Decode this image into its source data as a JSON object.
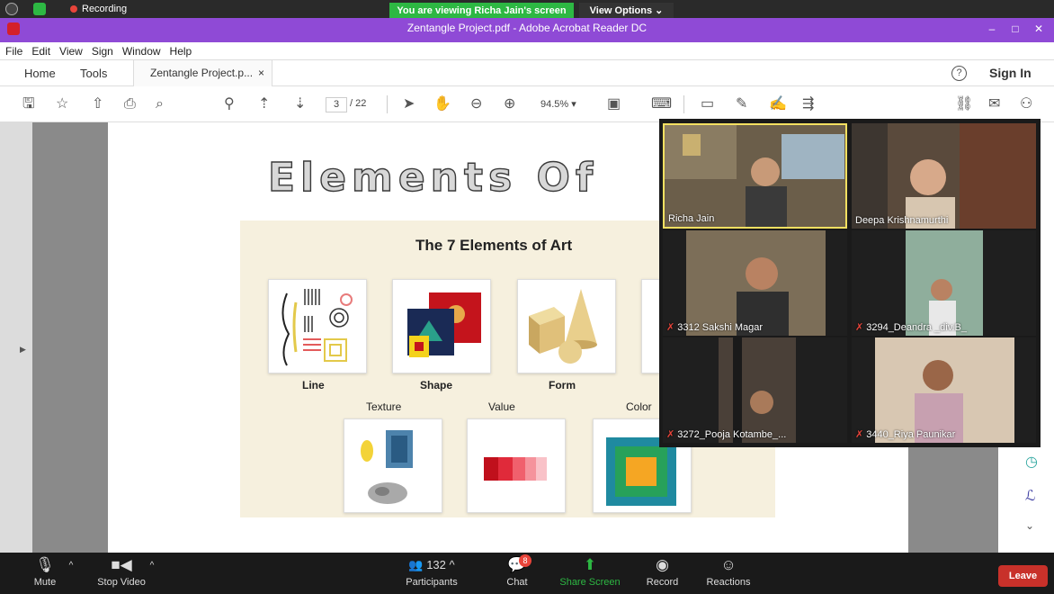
{
  "zoom_top": {
    "recording_label": "Recording",
    "viewing_banner": "You are viewing Richa Jain's screen",
    "view_options": "View Options ⌄"
  },
  "window": {
    "title": "Zentangle Project.pdf - Adobe Acrobat Reader DC",
    "minimize": "–",
    "maximize": "□",
    "close": "✕"
  },
  "menu": [
    "File",
    "Edit",
    "View",
    "Sign",
    "Window",
    "Help"
  ],
  "tabs": {
    "home": "Home",
    "tools": "Tools",
    "document": "Zentangle Project.p...",
    "close": "×",
    "sign_in": "Sign In",
    "help": "?"
  },
  "toolbar": {
    "page_current": "3",
    "page_total": "/ 22",
    "zoom": "94.5%  ▾"
  },
  "document": {
    "title": "Elements Of",
    "panel_title": "The 7 Elements of Art",
    "elements": {
      "line": "Line",
      "shape": "Shape",
      "form": "Form",
      "texture": "Texture",
      "value": "Value",
      "color": "Color"
    }
  },
  "participants_video": [
    {
      "name": "Richa Jain",
      "muted": false,
      "active": true
    },
    {
      "name": "Deepa Krishnamurthi",
      "muted": false,
      "active": false
    },
    {
      "name": "3312 Sakshi Magar",
      "muted": true,
      "active": false
    },
    {
      "name": "3294_Deandra _div.B_",
      "muted": true,
      "active": false
    },
    {
      "name": "3272_Pooja Kotambe_...",
      "muted": true,
      "active": false
    },
    {
      "name": "3440_Riya Paunikar",
      "muted": true,
      "active": false
    }
  ],
  "zoom_bar": {
    "mute": "Mute",
    "stop_video": "Stop Video",
    "participants": "Participants",
    "participants_count": "132",
    "chat": "Chat",
    "chat_badge": "8",
    "share_screen": "Share Screen",
    "record": "Record",
    "reactions": "Reactions",
    "leave": "Leave"
  },
  "colors": {
    "acrobat_purple": "#8f4ad6",
    "viewing_green": "#2db843",
    "leave_red": "#c8312a",
    "active_speaker": "#f4e061"
  }
}
